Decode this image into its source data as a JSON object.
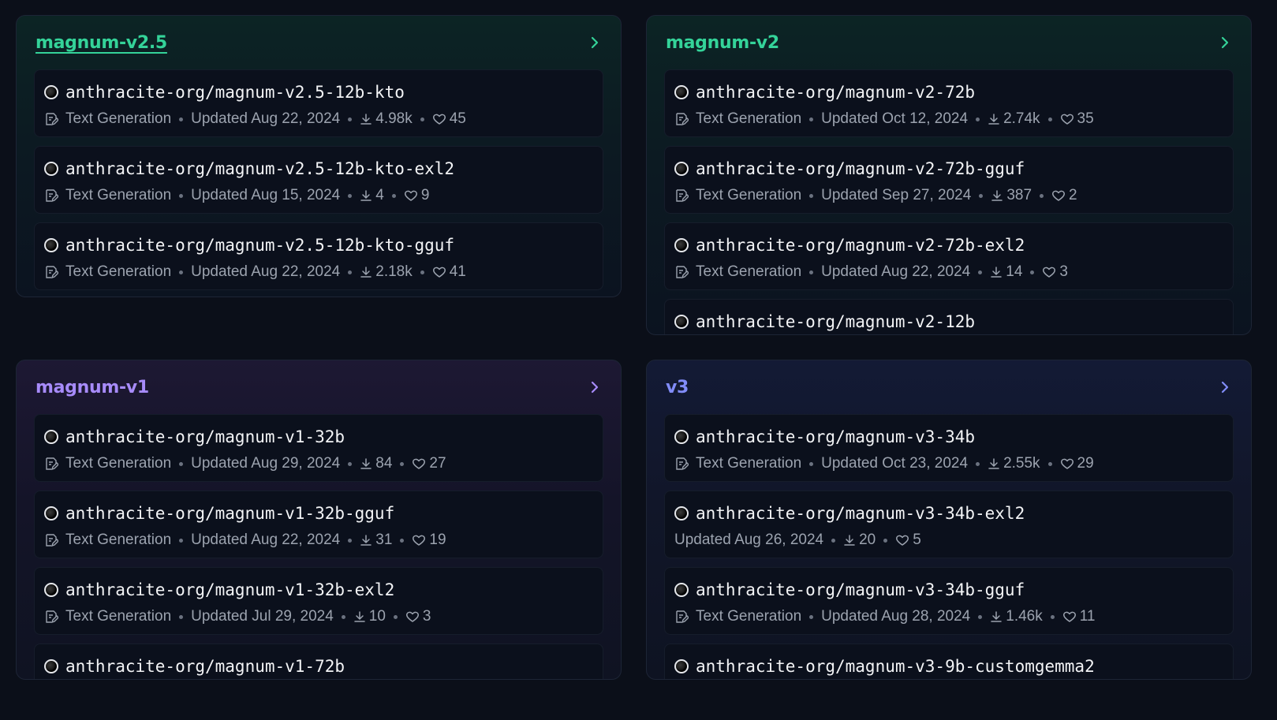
{
  "collections": [
    {
      "title": "magnum-v2.5",
      "items": [
        {
          "repo": "anthracite-org/magnum-v2.5-12b-kto",
          "task": "Text Generation",
          "updated": "Updated Aug 22, 2024",
          "downloads": "4.98k",
          "likes": "45"
        },
        {
          "repo": "anthracite-org/magnum-v2.5-12b-kto-exl2",
          "task": "Text Generation",
          "updated": "Updated Aug 15, 2024",
          "downloads": "4",
          "likes": "9"
        },
        {
          "repo": "anthracite-org/magnum-v2.5-12b-kto-gguf",
          "task": "Text Generation",
          "updated": "Updated Aug 22, 2024",
          "downloads": "2.18k",
          "likes": "41"
        }
      ]
    },
    {
      "title": "magnum-v2",
      "items": [
        {
          "repo": "anthracite-org/magnum-v2-72b",
          "task": "Text Generation",
          "updated": "Updated Oct 12, 2024",
          "downloads": "2.74k",
          "likes": "35"
        },
        {
          "repo": "anthracite-org/magnum-v2-72b-gguf",
          "task": "Text Generation",
          "updated": "Updated Sep 27, 2024",
          "downloads": "387",
          "likes": "2"
        },
        {
          "repo": "anthracite-org/magnum-v2-72b-exl2",
          "task": "Text Generation",
          "updated": "Updated Aug 22, 2024",
          "downloads": "14",
          "likes": "3"
        },
        {
          "repo": "anthracite-org/magnum-v2-12b"
        }
      ]
    },
    {
      "title": "magnum-v1",
      "items": [
        {
          "repo": "anthracite-org/magnum-v1-32b",
          "task": "Text Generation",
          "updated": "Updated Aug 29, 2024",
          "downloads": "84",
          "likes": "27"
        },
        {
          "repo": "anthracite-org/magnum-v1-32b-gguf",
          "task": "Text Generation",
          "updated": "Updated Aug 22, 2024",
          "downloads": "31",
          "likes": "19"
        },
        {
          "repo": "anthracite-org/magnum-v1-32b-exl2",
          "task": "Text Generation",
          "updated": "Updated Jul 29, 2024",
          "downloads": "10",
          "likes": "3"
        },
        {
          "repo": "anthracite-org/magnum-v1-72b"
        }
      ]
    },
    {
      "title": "v3",
      "items": [
        {
          "repo": "anthracite-org/magnum-v3-34b",
          "task": "Text Generation",
          "updated": "Updated Oct 23, 2024",
          "downloads": "2.55k",
          "likes": "29"
        },
        {
          "repo": "anthracite-org/magnum-v3-34b-exl2",
          "updated": "Updated Aug 26, 2024",
          "downloads": "20",
          "likes": "5"
        },
        {
          "repo": "anthracite-org/magnum-v3-34b-gguf",
          "task": "Text Generation",
          "updated": "Updated Aug 28, 2024",
          "downloads": "1.46k",
          "likes": "11"
        },
        {
          "repo": "anthracite-org/magnum-v3-9b-customgemma2"
        }
      ]
    }
  ],
  "colors": {
    "green_title": "#34d399",
    "purple_title": "#a78bfa",
    "indigo_title": "#818cf8",
    "meta_text": "#9ca3af"
  }
}
